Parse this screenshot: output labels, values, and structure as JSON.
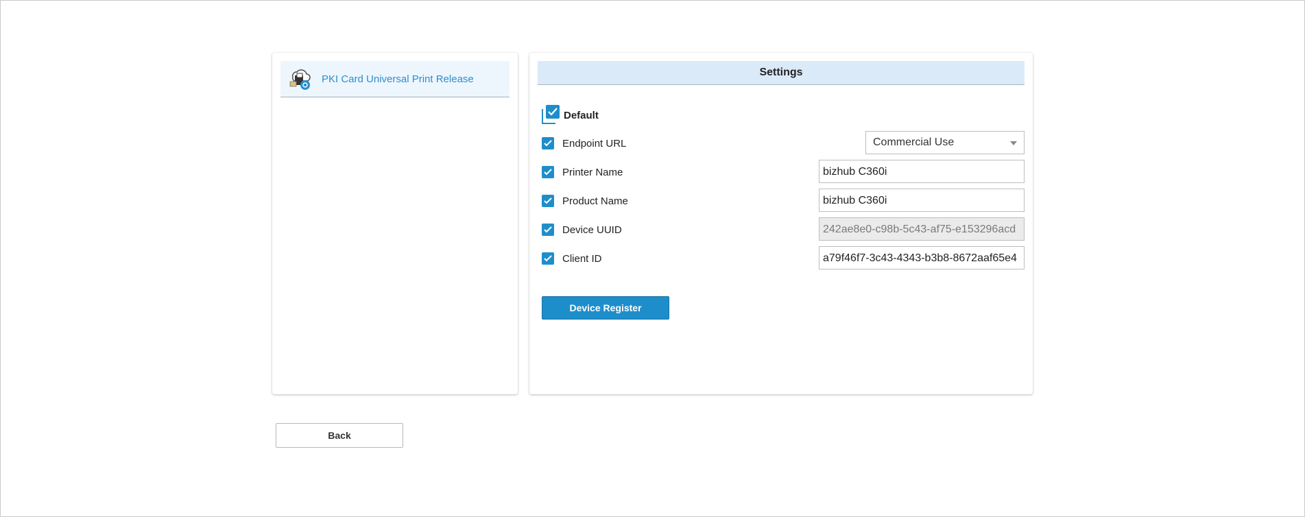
{
  "sidebar": {
    "app_label": "PKI Card Universal Print Release",
    "app_icon": "cloud-print-icon"
  },
  "settings": {
    "header": "Settings",
    "default_label": "Default",
    "default_checked": true,
    "fields": [
      {
        "label": "Endpoint URL",
        "checked": true,
        "type": "select",
        "value": "Commercial Use"
      },
      {
        "label": "Printer Name",
        "checked": true,
        "type": "text",
        "value": "bizhub C360i"
      },
      {
        "label": "Product Name",
        "checked": true,
        "type": "text",
        "value": "bizhub C360i"
      },
      {
        "label": "Device UUID",
        "checked": true,
        "type": "text",
        "disabled": true,
        "value": "242ae8e0-c98b-5c43-af75-e153296acd"
      },
      {
        "label": "Client ID",
        "checked": true,
        "type": "text",
        "value": "a79f46f7-3c43-4343-b3b8-8672aaf65e4"
      }
    ],
    "register_button": "Device Register"
  },
  "footer": {
    "back_button": "Back"
  },
  "colors": {
    "accent": "#1e8ecb",
    "header_bg": "#dbeaf9",
    "link": "#2a8fcf"
  }
}
